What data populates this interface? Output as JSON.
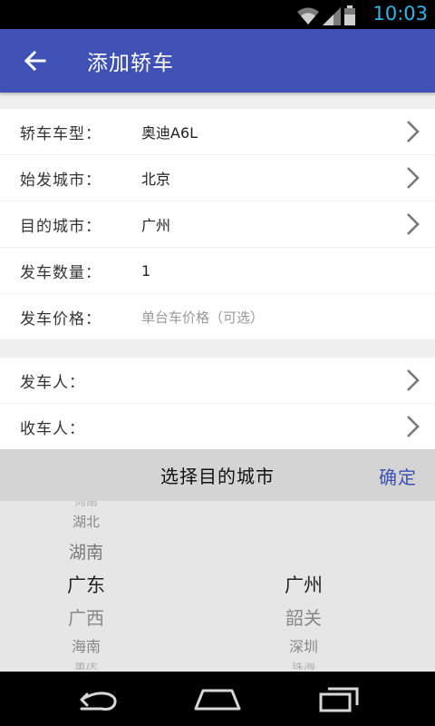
{
  "status": {
    "time": "10:03"
  },
  "appbar": {
    "title": "添加轿车"
  },
  "form": {
    "rows": [
      {
        "label": "轿车车型：",
        "value": "奥迪A6L"
      },
      {
        "label": "始发城市：",
        "value": "北京"
      },
      {
        "label": "目的城市：",
        "value": "广州"
      },
      {
        "label": "发车数量：",
        "value": "1"
      },
      {
        "label": "发车价格：",
        "placeholder": "单台车价格（可选）"
      }
    ],
    "people": [
      {
        "label": "发车人："
      },
      {
        "label": "收车人："
      }
    ]
  },
  "picker": {
    "title": "选择目的城市",
    "confirm": "确定",
    "provinces": [
      "河南",
      "湖北",
      "湖南",
      "广东",
      "广西",
      "海南",
      "重庆"
    ],
    "cities": [
      "广州",
      "韶关",
      "深圳",
      "珠海"
    ],
    "selected_province": "广东",
    "selected_city": "广州"
  },
  "colors": {
    "primary": "#3f51b5",
    "status_accent": "#33b5e5"
  }
}
